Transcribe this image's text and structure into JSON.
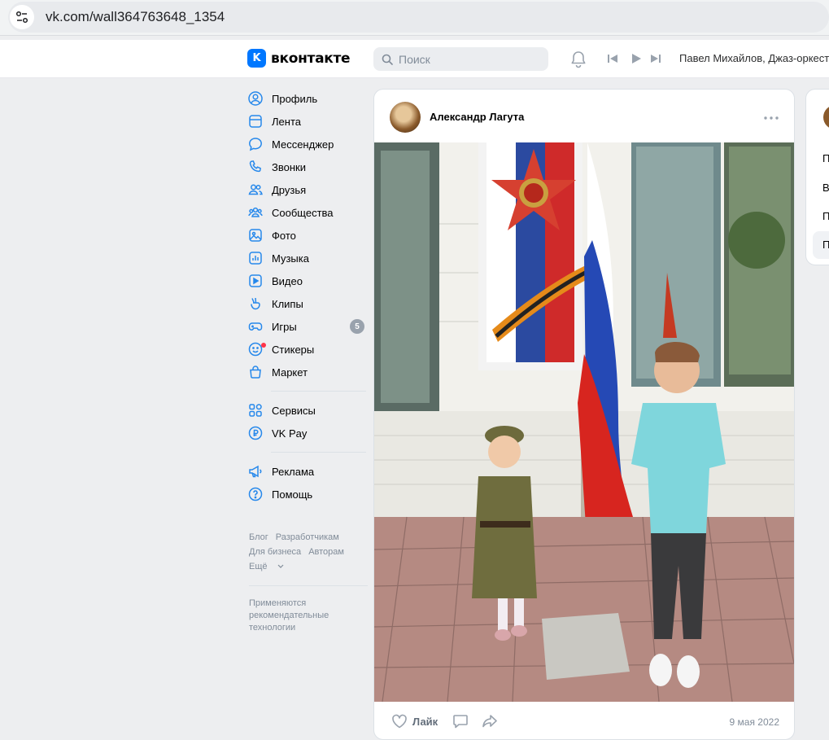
{
  "browser": {
    "url": "vk.com/wall364763648_1354"
  },
  "header": {
    "logo_letter": "K",
    "logo_text": "вконтакте",
    "search_placeholder": "Поиск",
    "now_playing": "Павел Михайлов, Джаз-оркест"
  },
  "nav": {
    "items": [
      {
        "label": "Профиль",
        "icon": "user-circle-icon"
      },
      {
        "label": "Лента",
        "icon": "newsfeed-icon"
      },
      {
        "label": "Мессенджер",
        "icon": "message-icon"
      },
      {
        "label": "Звонки",
        "icon": "phone-icon"
      },
      {
        "label": "Друзья",
        "icon": "friends-icon"
      },
      {
        "label": "Сообщества",
        "icon": "communities-icon"
      },
      {
        "label": "Фото",
        "icon": "photo-icon"
      },
      {
        "label": "Музыка",
        "icon": "music-icon"
      },
      {
        "label": "Видео",
        "icon": "video-icon"
      },
      {
        "label": "Клипы",
        "icon": "clips-icon"
      },
      {
        "label": "Игры",
        "icon": "gamepad-icon",
        "badge": "5"
      },
      {
        "label": "Стикеры",
        "icon": "sticker-icon"
      },
      {
        "label": "Маркет",
        "icon": "market-bag-icon"
      }
    ],
    "items2": [
      {
        "label": "Сервисы",
        "icon": "services-icon"
      },
      {
        "label": "VK Pay",
        "icon": "vkpay-icon"
      }
    ],
    "items3": [
      {
        "label": "Реклама",
        "icon": "megaphone-icon"
      },
      {
        "label": "Помощь",
        "icon": "help-icon"
      }
    ]
  },
  "footer": {
    "links": [
      "Блог",
      "Разработчикам",
      "Для бизнеса",
      "Авторам",
      "Ещё"
    ],
    "note": "Применяются рекомендательные технологии"
  },
  "post": {
    "author": "Александр Лагута",
    "like_label": "Лайк",
    "date": "9 мая 2022"
  },
  "right_card": {
    "items": [
      "П",
      "Во",
      "П",
      "П"
    ]
  },
  "colors": {
    "accent": "#0077ff",
    "icon": "#2688eb",
    "background": "#edeef0"
  }
}
